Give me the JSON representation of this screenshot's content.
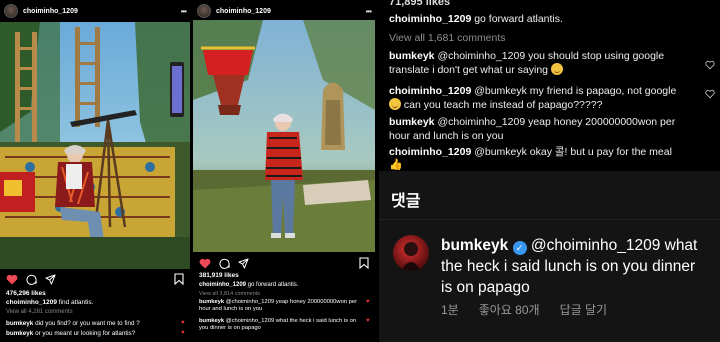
{
  "colors": {
    "background": "#000000",
    "like_red": "#ed4956",
    "verified_blue": "#3897f0",
    "muted": "#8e8e8e"
  },
  "post1": {
    "username": "choiminho_1209",
    "likes": "476,296 likes",
    "caption_user": "choiminho_1209",
    "caption_text": "find atlantis.",
    "view_all": "View all 4,281 comments",
    "comments": [
      {
        "user": "bumkeyk",
        "text": "did you find? or you want me to find ?"
      },
      {
        "user": "bumkeyk",
        "text": "or you meant ur looking for atlantis?"
      }
    ],
    "icons": [
      "heart-filled-icon",
      "comment-icon",
      "share-icon",
      "bookmark-icon"
    ]
  },
  "post2": {
    "username": "choiminho_1209",
    "likes": "381,919 likes",
    "caption_user": "choiminho_1209",
    "caption_text": "go forward atlantis.",
    "view_all": "View all 3,814 comments",
    "comments": [
      {
        "user": "bumkeyk",
        "text": "@choiminho_1209 yeap honey 200000000won per hour and lunch is on you"
      },
      {
        "user": "bumkeyk",
        "text": "@choiminho_1209 what the heck i said lunch is on you dinner is on papago"
      }
    ]
  },
  "zoom": {
    "likes": "71,895 likes",
    "caption_user": "choiminho_1209",
    "caption_text": "go forward atlantis.",
    "view_all": "View all 1,681 comments",
    "comments": [
      {
        "user": "bumkeyk",
        "text": "@choiminho_1209 you should stop using google translate i don't get what ur saying"
      },
      {
        "user": "choiminho_1209",
        "text": "@bumkeyk my friend is papago, not google"
      },
      {
        "user": "",
        "text": "can you teach me instead of papago?????"
      },
      {
        "user": "bumkeyk",
        "text": "@choiminho_1209 yeap honey 200000000won per hour and lunch is on you"
      },
      {
        "user": "choiminho_1209",
        "text": "@bumkeyk okay 콜! but u pay for the meal"
      }
    ]
  },
  "korean": {
    "title": "댓글",
    "user": "bumkeyk",
    "text": "@choiminho_1209 what the heck i said lunch is on you dinner is on papago",
    "time": "1분",
    "likes": "좋아요 80개",
    "reply": "답글 달기"
  }
}
